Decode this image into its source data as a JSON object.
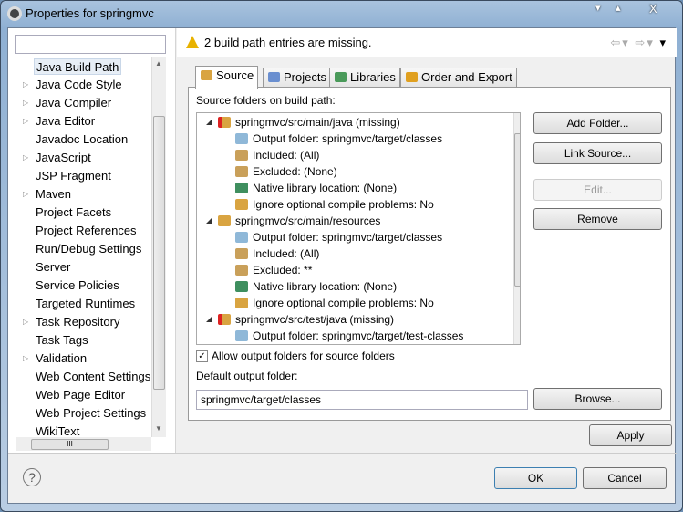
{
  "window": {
    "title": "Properties for springmvc",
    "controls": [
      "▾",
      "▴",
      "X"
    ]
  },
  "sidebar": {
    "filter_value": "",
    "selected": "Java Build Path",
    "items": [
      {
        "label": "Java Build Path",
        "expandable": false
      },
      {
        "label": "Java Code Style",
        "expandable": true
      },
      {
        "label": "Java Compiler",
        "expandable": true
      },
      {
        "label": "Java Editor",
        "expandable": true
      },
      {
        "label": "Javadoc Location",
        "expandable": false
      },
      {
        "label": "JavaScript",
        "expandable": true
      },
      {
        "label": "JSP Fragment",
        "expandable": false
      },
      {
        "label": "Maven",
        "expandable": true
      },
      {
        "label": "Project Facets",
        "expandable": false
      },
      {
        "label": "Project References",
        "expandable": false
      },
      {
        "label": "Run/Debug Settings",
        "expandable": false
      },
      {
        "label": "Server",
        "expandable": false
      },
      {
        "label": "Service Policies",
        "expandable": false
      },
      {
        "label": "Targeted Runtimes",
        "expandable": false
      },
      {
        "label": "Task Repository",
        "expandable": true
      },
      {
        "label": "Task Tags",
        "expandable": false
      },
      {
        "label": "Validation",
        "expandable": true
      },
      {
        "label": "Web Content Settings",
        "expandable": false
      },
      {
        "label": "Web Page Editor",
        "expandable": false
      },
      {
        "label": "Web Project Settings",
        "expandable": false
      },
      {
        "label": "WikiText",
        "expandable": false
      }
    ]
  },
  "header": {
    "message": "2 build path entries are missing.",
    "icon": "warning-icon"
  },
  "tabs": [
    {
      "label": "Source",
      "selected": true,
      "color": "#d9a441"
    },
    {
      "label": "Projects",
      "color": "#6a8fd0"
    },
    {
      "label": "Libraries",
      "color": "#4a9a5a"
    },
    {
      "label": "Order and Export",
      "color": "#e0a020"
    }
  ],
  "source": {
    "tree_label": "Source folders on build path:",
    "tree": [
      {
        "level": 0,
        "label": "springmvc/src/main/java (missing)",
        "icon": "missing-package-folder-icon"
      },
      {
        "level": 1,
        "label": "Output folder: springmvc/target/classes",
        "icon": "output-folder-icon"
      },
      {
        "level": 1,
        "label": "Included: (All)",
        "icon": "inclusion-filter-icon"
      },
      {
        "level": 1,
        "label": "Excluded: (None)",
        "icon": "exclusion-filter-icon"
      },
      {
        "level": 1,
        "label": "Native library location: (None)",
        "icon": "native-library-icon"
      },
      {
        "level": 1,
        "label": "Ignore optional compile problems: No",
        "icon": "ignore-problems-icon"
      },
      {
        "level": 0,
        "label": "springmvc/src/main/resources",
        "icon": "package-folder-icon"
      },
      {
        "level": 1,
        "label": "Output folder: springmvc/target/classes",
        "icon": "output-folder-icon"
      },
      {
        "level": 1,
        "label": "Included: (All)",
        "icon": "inclusion-filter-icon"
      },
      {
        "level": 1,
        "label": "Excluded: **",
        "icon": "exclusion-filter-icon"
      },
      {
        "level": 1,
        "label": "Native library location: (None)",
        "icon": "native-library-icon"
      },
      {
        "level": 1,
        "label": "Ignore optional compile problems: No",
        "icon": "ignore-problems-icon"
      },
      {
        "level": 0,
        "label": "springmvc/src/test/java (missing)",
        "icon": "missing-package-folder-icon"
      },
      {
        "level": 1,
        "label": "Output folder: springmvc/target/test-classes",
        "icon": "output-folder-icon"
      }
    ],
    "buttons": {
      "add_folder": "Add Folder...",
      "link_source": "Link Source...",
      "edit": "Edit...",
      "remove": "Remove"
    },
    "allow_output_label": "Allow output folders for source folders",
    "allow_output_checked": true,
    "default_output_label": "Default output folder:",
    "default_output_value": "springmvc/target/classes",
    "browse": "Browse..."
  },
  "buttons": {
    "apply": "Apply",
    "ok": "OK",
    "cancel": "Cancel",
    "help": "?"
  }
}
